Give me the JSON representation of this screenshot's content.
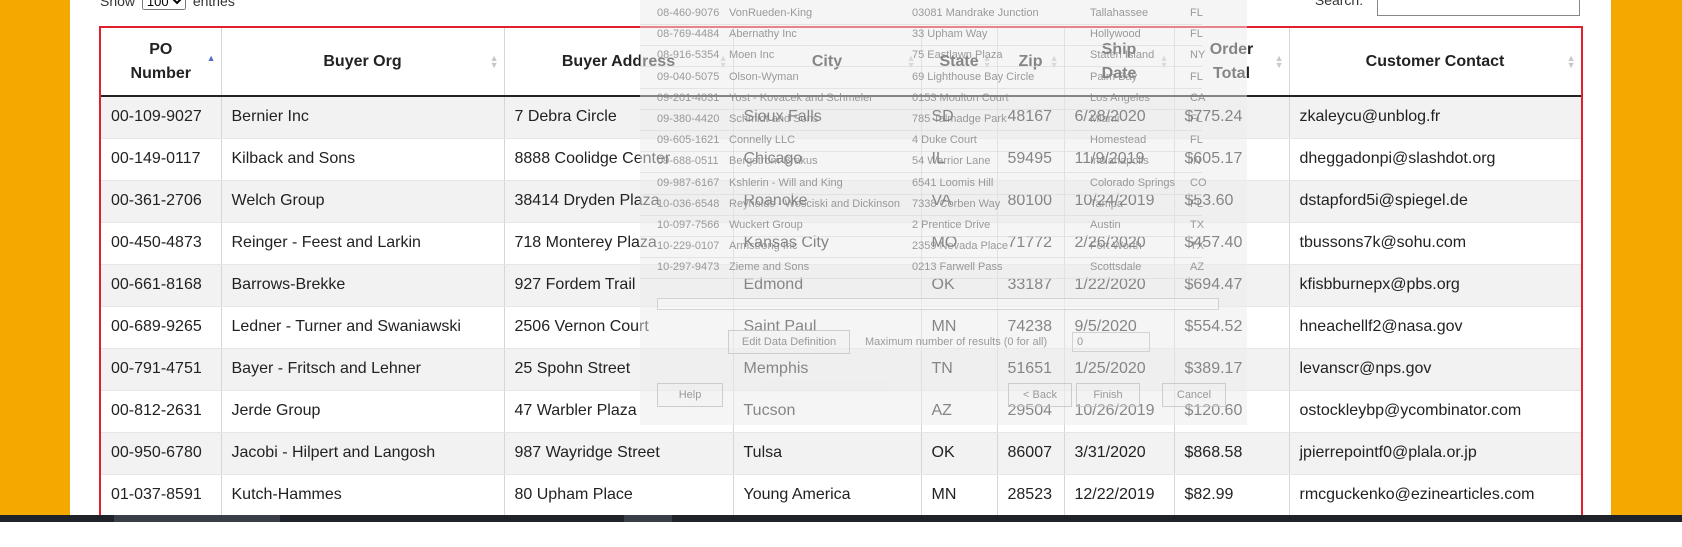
{
  "controls": {
    "show_label": "Show",
    "show_value": "100",
    "entries_label": "entries",
    "search_label": "Search:"
  },
  "columns": [
    {
      "label_lines": [
        "PO",
        "Number"
      ],
      "sort": "asc"
    },
    {
      "label_lines": [
        "Buyer Org"
      ],
      "sort": "both"
    },
    {
      "label_lines": [
        "Buyer Address"
      ],
      "sort": "both"
    },
    {
      "label_lines": [
        "City"
      ],
      "sort": "both"
    },
    {
      "label_lines": [
        "State"
      ],
      "sort": "both"
    },
    {
      "label_lines": [
        "Zip"
      ],
      "sort": "both"
    },
    {
      "label_lines": [
        "Ship",
        "Date"
      ],
      "sort": "both"
    },
    {
      "label_lines": [
        "Order",
        "Total"
      ],
      "sort": "both"
    },
    {
      "label_lines": [
        "Customer Contact"
      ],
      "sort": "both"
    }
  ],
  "rows": [
    [
      "00-109-9027",
      "Bernier Inc",
      "7 Debra Circle",
      "Sioux Falls",
      "SD",
      "48167",
      "6/28/2020",
      "$775.24",
      "zkaleycu@unblog.fr"
    ],
    [
      "00-149-0117",
      "Kilback and Sons",
      "8888 Coolidge Center",
      "Chicago",
      "IL",
      "59495",
      "11/9/2019",
      "$605.17",
      "dheggadonpi@slashdot.org"
    ],
    [
      "00-361-2706",
      "Welch Group",
      "38414 Dryden Plaza",
      "Roanoke",
      "VA",
      "80100",
      "10/24/2019",
      "$53.60",
      "dstapford5i@spiegel.de"
    ],
    [
      "00-450-4873",
      "Reinger - Feest and Larkin",
      "718 Monterey Plaza",
      "Kansas City",
      "MO",
      "71772",
      "2/26/2020",
      "$457.40",
      "tbussons7k@sohu.com"
    ],
    [
      "00-661-8168",
      "Barrows-Brekke",
      "927 Fordem Trail",
      "Edmond",
      "OK",
      "33187",
      "1/22/2020",
      "$694.47",
      "kfisbburnepx@pbs.org"
    ],
    [
      "00-689-9265",
      "Ledner - Turner and Swaniawski",
      "2506 Vernon Court",
      "Saint Paul",
      "MN",
      "74238",
      "9/5/2020",
      "$554.52",
      "hneachellf2@nasa.gov"
    ],
    [
      "00-791-4751",
      "Bayer - Fritsch and Lehner",
      "25 Spohn Street",
      "Memphis",
      "TN",
      "51651",
      "1/25/2020",
      "$389.17",
      "levanscr@nps.gov"
    ],
    [
      "00-812-2631",
      "Jerde Group",
      "47 Warbler Plaza",
      "Tucson",
      "AZ",
      "29504",
      "10/26/2019",
      "$120.60",
      "ostockleybp@ycombinator.com"
    ],
    [
      "00-950-6780",
      "Jacobi - Hilpert and Langosh",
      "987 Wayridge Street",
      "Tulsa",
      "OK",
      "86007",
      "3/31/2020",
      "$868.58",
      "jpierrepointf0@plala.or.jp"
    ],
    [
      "01-037-8591",
      "Kutch-Hammes",
      "80 Upham Place",
      "Young America",
      "MN",
      "28523",
      "12/22/2019",
      "$82.99",
      "rmcguckenko@ezinearticles.com"
    ]
  ],
  "ghost_dialog": {
    "rows": [
      [
        "08-460-9076",
        "VonRueden-King",
        "03081 Mandrake Junction",
        "Tallahassee",
        "FL"
      ],
      [
        "08-769-4484",
        "Abernathy Inc",
        "33 Upham Way",
        "Hollywood",
        "FL"
      ],
      [
        "08-916-5354",
        "Moen Inc",
        "75 Eastlawn Plaza",
        "Staten Island",
        "NY"
      ],
      [
        "09-040-5075",
        "Olson-Wyman",
        "69 Lighthouse Bay Circle",
        "Palm Bay",
        "FL"
      ],
      [
        "09-201-4031",
        "Yost - Kovacek and Schmeler",
        "0153 Moulton Court",
        "Los Angeles",
        "CA"
      ],
      [
        "09-380-4420",
        "Schmidt and Sons",
        "785 Talmadge Park",
        "Miami",
        "FL"
      ],
      [
        "09-605-1621",
        "Connelly LLC",
        "4 Duke Court",
        "Homestead",
        "FL"
      ],
      [
        "09-688-0511",
        "Bergstrom-Brakus",
        "54 Warrior Lane",
        "Indianapolis",
        "IN"
      ],
      [
        "09-987-6167",
        "Kshlerin - Will and King",
        "6541 Loomis Hill",
        "Colorado Springs",
        "CO"
      ],
      [
        "10-036-6548",
        "Reynolds - Wosciski and Dickinson",
        "7338 Corben Way",
        "Tampa",
        "FL"
      ],
      [
        "10-097-7566",
        "Wuckert Group",
        "2 Prentice Drive",
        "Austin",
        "TX"
      ],
      [
        "10-229-0107",
        "Armstrong Inc",
        "2359 Nevada Place",
        "Fort Worth",
        "TX"
      ],
      [
        "10-297-9473",
        "Zieme and Sons",
        "0213 Farwell Pass",
        "Scottsdale",
        "AZ"
      ]
    ],
    "edit_button": "Edit Data Definition",
    "max_results_label": "Maximum number of results (0 for all)",
    "max_results_value": "0",
    "help_button": "Help",
    "back_button": "< Back",
    "finish_button": "Finish",
    "cancel_button": "Cancel"
  }
}
